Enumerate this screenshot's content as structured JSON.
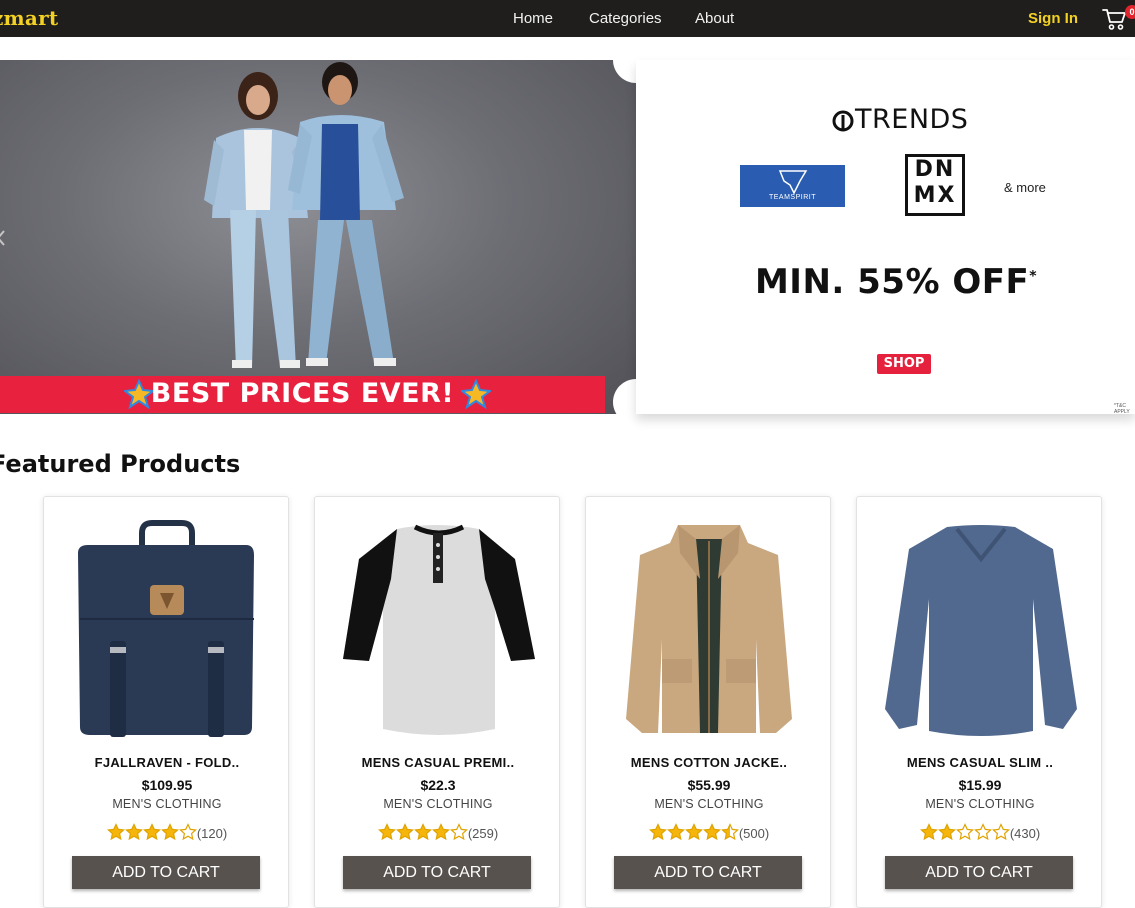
{
  "navbar": {
    "brand": "zmart",
    "links": [
      "Home",
      "Categories",
      "About"
    ],
    "sign_in": "Sign In",
    "cart_count": "0",
    "brand_color": "#f2d024"
  },
  "banner": {
    "headline": "BEST PRICES EVER!",
    "trends_brand": "TRENDS",
    "teamspirit_brand": "TEAMSPIRIT",
    "dnmx_line1": "DN",
    "dnmx_line2": "MX",
    "and_more": "& more",
    "offer": "MIN. 55% OFF",
    "offer_mark": "*",
    "shop_label": "SHOP",
    "tnc": "*T&C APPLY"
  },
  "featured": {
    "title": "Featured Products",
    "products": [
      {
        "title": "FJALLRAVEN - FOLD..",
        "price": "$109.95",
        "category": "MEN'S CLOTHING",
        "rating": 4,
        "count": "(120)",
        "button": "ADD TO CART",
        "image": "backpack"
      },
      {
        "title": "MENS CASUAL PREMI..",
        "price": "$22.3",
        "category": "MEN'S CLOTHING",
        "rating": 4,
        "count": "(259)",
        "button": "ADD TO CART",
        "image": "raglan-tshirt"
      },
      {
        "title": "MENS COTTON JACKE..",
        "price": "$55.99",
        "category": "MEN'S CLOTHING",
        "rating": 4.5,
        "count": "(500)",
        "button": "ADD TO CART",
        "image": "cotton-jacket"
      },
      {
        "title": "MENS CASUAL SLIM ..",
        "price": "$15.99",
        "category": "MEN'S CLOTHING",
        "rating": 2,
        "count": "(430)",
        "button": "ADD TO CART",
        "image": "slim-tee"
      }
    ]
  }
}
